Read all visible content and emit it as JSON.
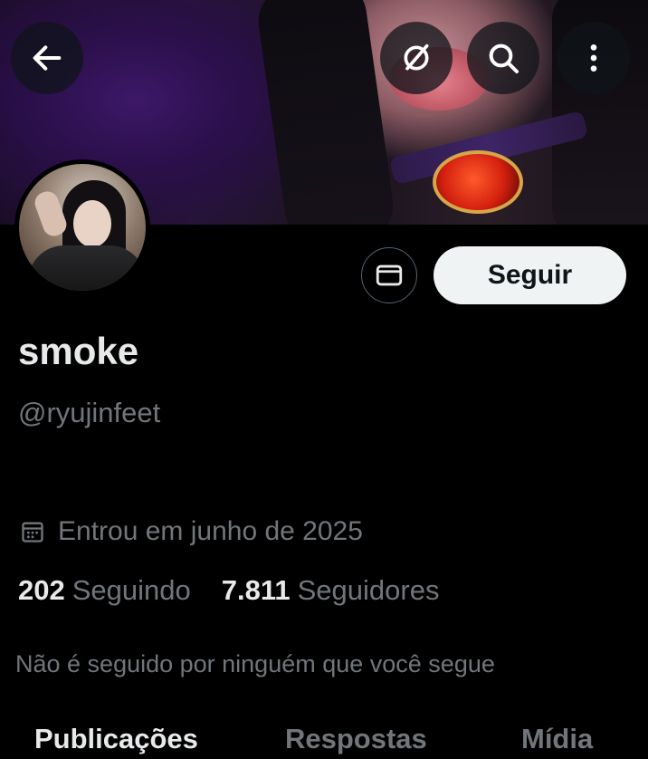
{
  "header": {
    "back_icon": "arrow-left-icon",
    "grok_icon": "slash-circle-icon",
    "search_icon": "search-icon",
    "more_icon": "more-vertical-icon"
  },
  "profile": {
    "name": "smoke",
    "handle": "@ryujinfeet",
    "joined": "Entrou em junho de 2025",
    "following_count": "202",
    "following_label": "Seguindo",
    "followers_count": "7.811",
    "followers_label": "Seguidores",
    "not_followed_text": "Não é seguido por ninguém que você segue"
  },
  "actions": {
    "message_icon": "mail-icon",
    "follow_label": "Seguir"
  },
  "tabs": [
    {
      "label": "Publicações",
      "active": true
    },
    {
      "label": "Respostas",
      "active": false
    },
    {
      "label": "Mídia",
      "active": false
    }
  ],
  "colors": {
    "background": "#000000",
    "primary_text": "#e7e9ea",
    "secondary_text": "#71767b",
    "follow_button_bg": "#eff3f4"
  }
}
